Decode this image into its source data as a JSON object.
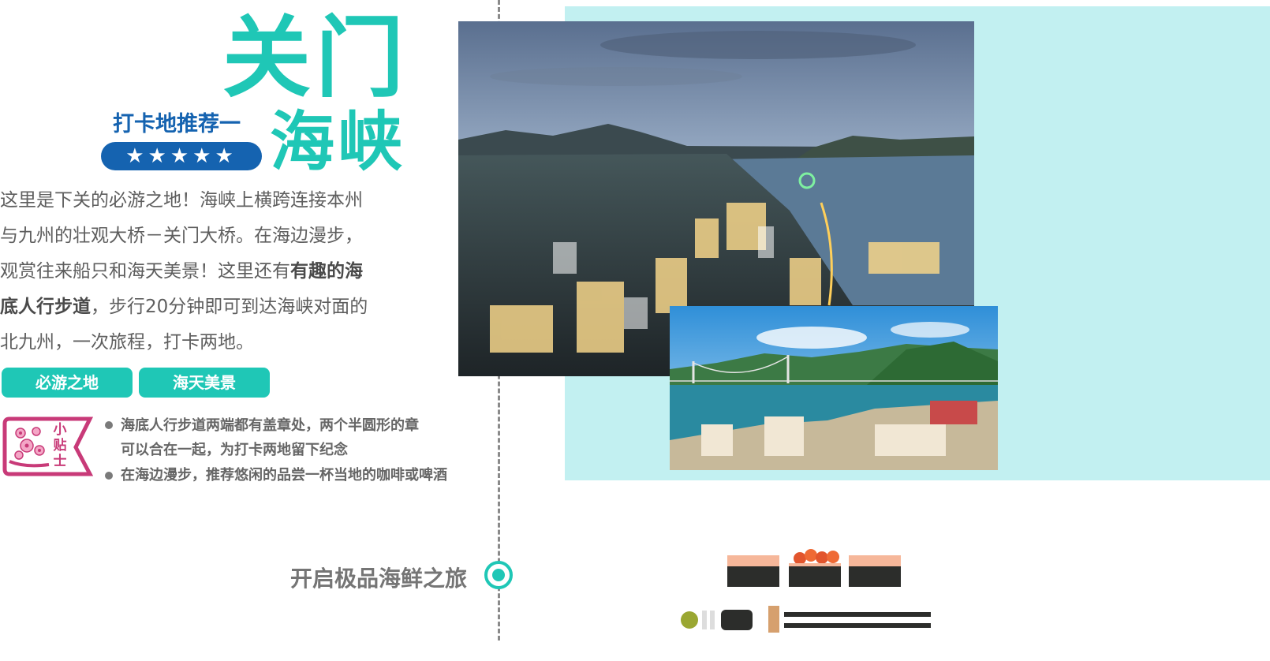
{
  "title": {
    "line1": "关门",
    "line2": "海峡",
    "recommend_label": "打卡地推荐一",
    "stars": "★★★★★"
  },
  "description": {
    "p1": "这里是下关的必游之地！海峡上横跨连接本州",
    "p2": "与九州的壮观大桥－关门大桥。在海边漫步，",
    "p3a": "观赏往来船只和海天美景！这里还有",
    "p3b": "有趣的海",
    "p4a": "底人行步道",
    "p4b": "，步行20分钟即可到达海峡对面的",
    "p5": "北九州，一次旅程，打卡两地。"
  },
  "tags": [
    "必游之地",
    "海天美景"
  ],
  "tips": {
    "badge": [
      "小",
      "贴",
      "士"
    ],
    "items": [
      "海底人行步道两端都有盖章处，两个半圆形的章",
      "可以合在一起，为打卡两地留下纪念",
      "在海边漫步，推荐悠闲的品尝一杯当地的咖啡或啤酒"
    ]
  },
  "footer": {
    "journey": "开启极品海鲜之旅"
  },
  "colors": {
    "accent": "#1fc7b6",
    "brand_blue": "#1563b0",
    "panel": "#c2f0f1",
    "badge_pink": "#c83a78"
  },
  "icons": [
    "sakura-icon",
    "sushi-icon",
    "chopsticks-icon"
  ]
}
